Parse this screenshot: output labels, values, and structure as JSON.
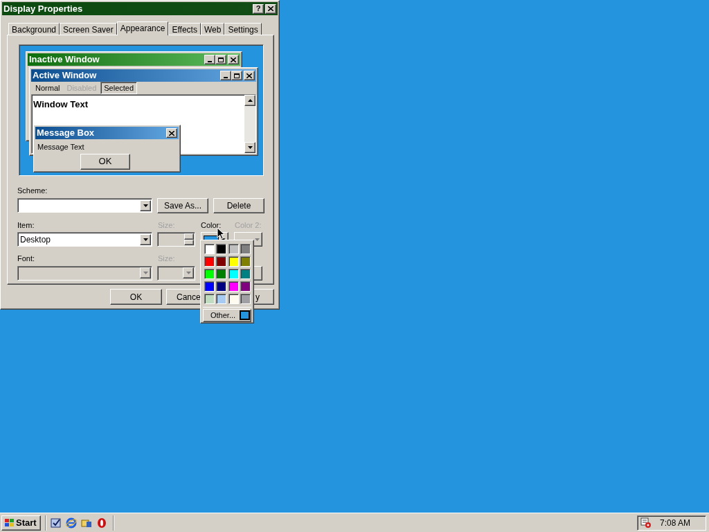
{
  "dialog": {
    "title": "Display Properties",
    "help_button": "?"
  },
  "tabs": [
    {
      "label": "Background",
      "selected": false
    },
    {
      "label": "Screen Saver",
      "selected": false
    },
    {
      "label": "Appearance",
      "selected": true
    },
    {
      "label": "Effects",
      "selected": false
    },
    {
      "label": "Web",
      "selected": false
    },
    {
      "label": "Settings",
      "selected": false
    }
  ],
  "preview": {
    "inactive_title": "Inactive Window",
    "active_title": "Active Window",
    "menu": [
      {
        "label": "Normal",
        "kind": "normal"
      },
      {
        "label": "Disabled",
        "kind": "disabled"
      },
      {
        "label": "Selected",
        "kind": "selected"
      }
    ],
    "window_text": "Window Text",
    "message_title": "Message Box",
    "message_text": "Message Text",
    "ok_button": "OK"
  },
  "scheme": {
    "label": "Scheme:",
    "save_as": "Save As...",
    "delete": "Delete"
  },
  "item": {
    "label": "Item:",
    "value": "Desktop",
    "size_label": "Size:",
    "size_disabled": true,
    "color_label": "Color:",
    "color": "#2394dd",
    "color2_label": "Color 2:",
    "color2_disabled": true
  },
  "font": {
    "label": "Font:",
    "disabled": true,
    "size_label": "Size:",
    "size_disabled": true
  },
  "palette": {
    "colors": [
      {
        "color": "#ffffff"
      },
      {
        "color": "#000000"
      },
      {
        "color": "#c0c0c0"
      },
      {
        "color": "#808080"
      },
      {
        "color": "#ff0000"
      },
      {
        "color": "#800000"
      },
      {
        "color": "#ffff00"
      },
      {
        "color": "#808000"
      },
      {
        "color": "#00ff00"
      },
      {
        "color": "#008000"
      },
      {
        "color": "#00ffff"
      },
      {
        "color": "#008080"
      },
      {
        "color": "#0000ff"
      },
      {
        "color": "#000080"
      },
      {
        "color": "#ff00ff"
      },
      {
        "color": "#800080"
      },
      {
        "color": "#c0dcc0"
      },
      {
        "color": "#a6caf0"
      },
      {
        "color": "#fffbf0"
      },
      {
        "color": "#a0a0a4"
      }
    ],
    "other": "Other...",
    "current": {
      "color": "#2394dd"
    }
  },
  "footer": {
    "ok": "OK",
    "cancel": "Cance",
    "apply": "y"
  },
  "taskbar": {
    "start": "Start",
    "clock": "7:08 AM"
  }
}
